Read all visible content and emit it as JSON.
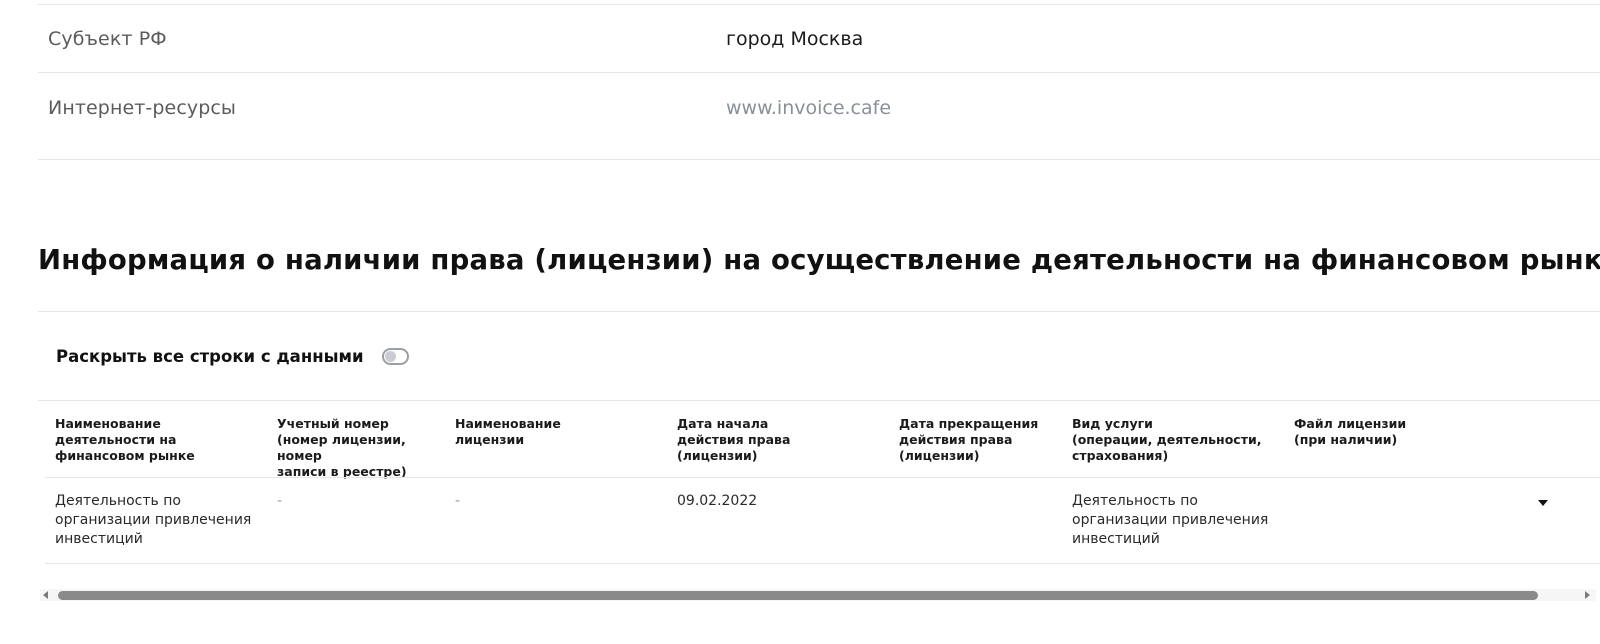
{
  "details": {
    "subject": {
      "label": "Субъект РФ",
      "value": "город Москва"
    },
    "internet": {
      "label": "Интернет-ресурсы",
      "value": "www.invoice.cafe"
    }
  },
  "license_section": {
    "title": "Информация о наличии права (лицензии) на осуществление деятельности на финансовом рынке",
    "expand_label": "Раскрыть все строки с данными",
    "expand_toggle_on": false,
    "columns": [
      "Наименование деятельности на\nфинансовом рынке",
      "Учетный номер\n(номер лицензии, номер\nзаписи в реестре)",
      "Наименование\nлицензии",
      "Дата начала\nдействия права\n(лицензии)",
      "Дата прекращения\nдействия права\n(лицензии)",
      "Вид услуги\n(операции, деятельности,\nстрахования)",
      "Файл лицензии\n(при наличии)"
    ],
    "rows": [
      {
        "activity": "Деятельность по\nорганизации привлечения\nинвестиций",
        "registry_number": "-",
        "license_name": "-",
        "start_date": "09.02.2022",
        "end_date": "",
        "service_type": "Деятельность по\nорганизации привлечения\nинвестиций",
        "license_file": "",
        "expand_icon": "chevron-down-icon"
      }
    ]
  },
  "scrollbar": {
    "position": 0.0
  }
}
